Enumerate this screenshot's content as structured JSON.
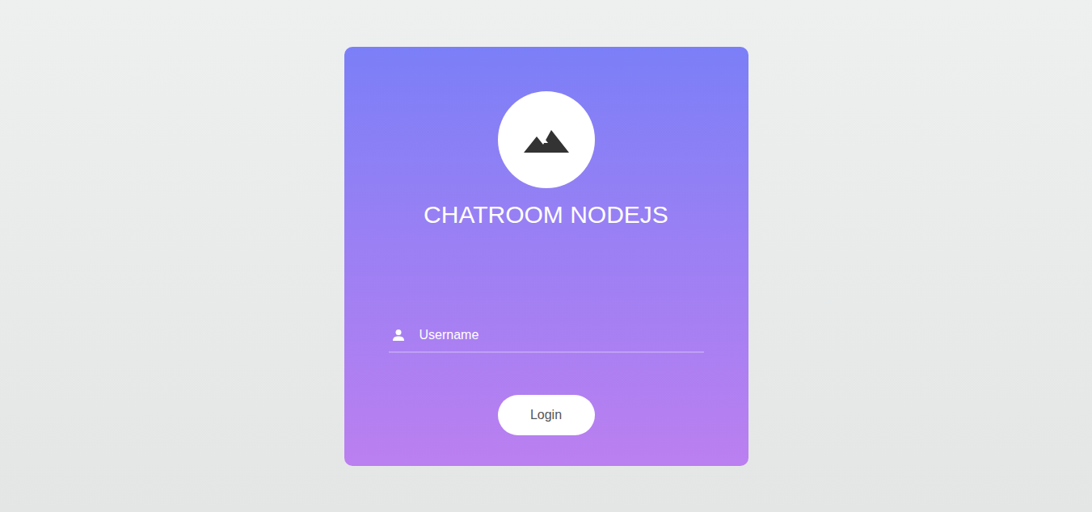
{
  "login": {
    "title": "CHATROOM NODEJS",
    "username_placeholder": "Username",
    "button": "Login"
  }
}
